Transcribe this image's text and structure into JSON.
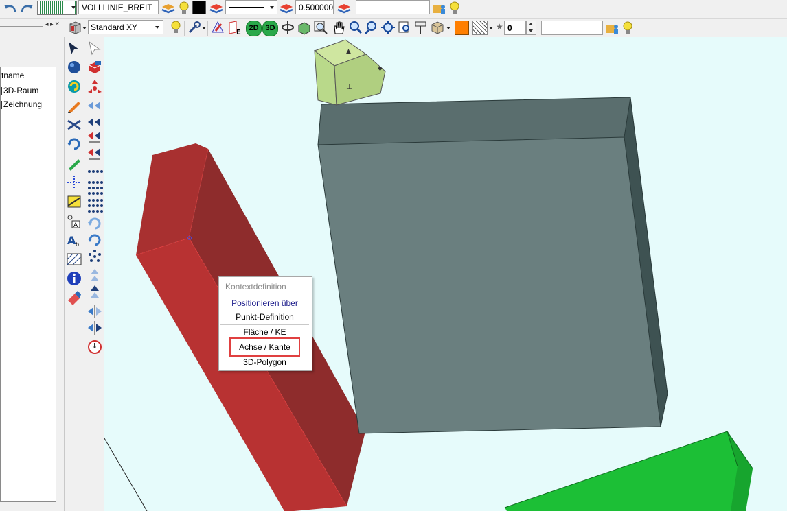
{
  "toolbar1": {
    "linetype_name": "VOLLLINIE_BREIT",
    "line_width": "0.500000",
    "empty_field": ""
  },
  "toolbar2": {
    "view_select": "Standard XY",
    "btn_2d": "2D",
    "btn_3d": "3D",
    "spin_value": "0",
    "empty_field": "",
    "fill_color": "#ff7f00"
  },
  "left_panel": {
    "header": "tname",
    "items": [
      "3D-Raum",
      "Zeichnung"
    ]
  },
  "context_menu": {
    "title": "Kontextdefinition",
    "subtitle": "Positionieren über",
    "items": [
      "Punkt-Definition",
      "Fläche / KE",
      "Achse / Kante",
      "3D-Polygon"
    ],
    "highlighted": "Achse / Kante"
  },
  "colors": {
    "viewport_bg": "#e6fbfb",
    "red_box": "#b83232",
    "gray_box": "#6a7f7f",
    "green_box": "#1cbf36",
    "view_cube": "#b9d98a",
    "highlight": "#e04040"
  }
}
